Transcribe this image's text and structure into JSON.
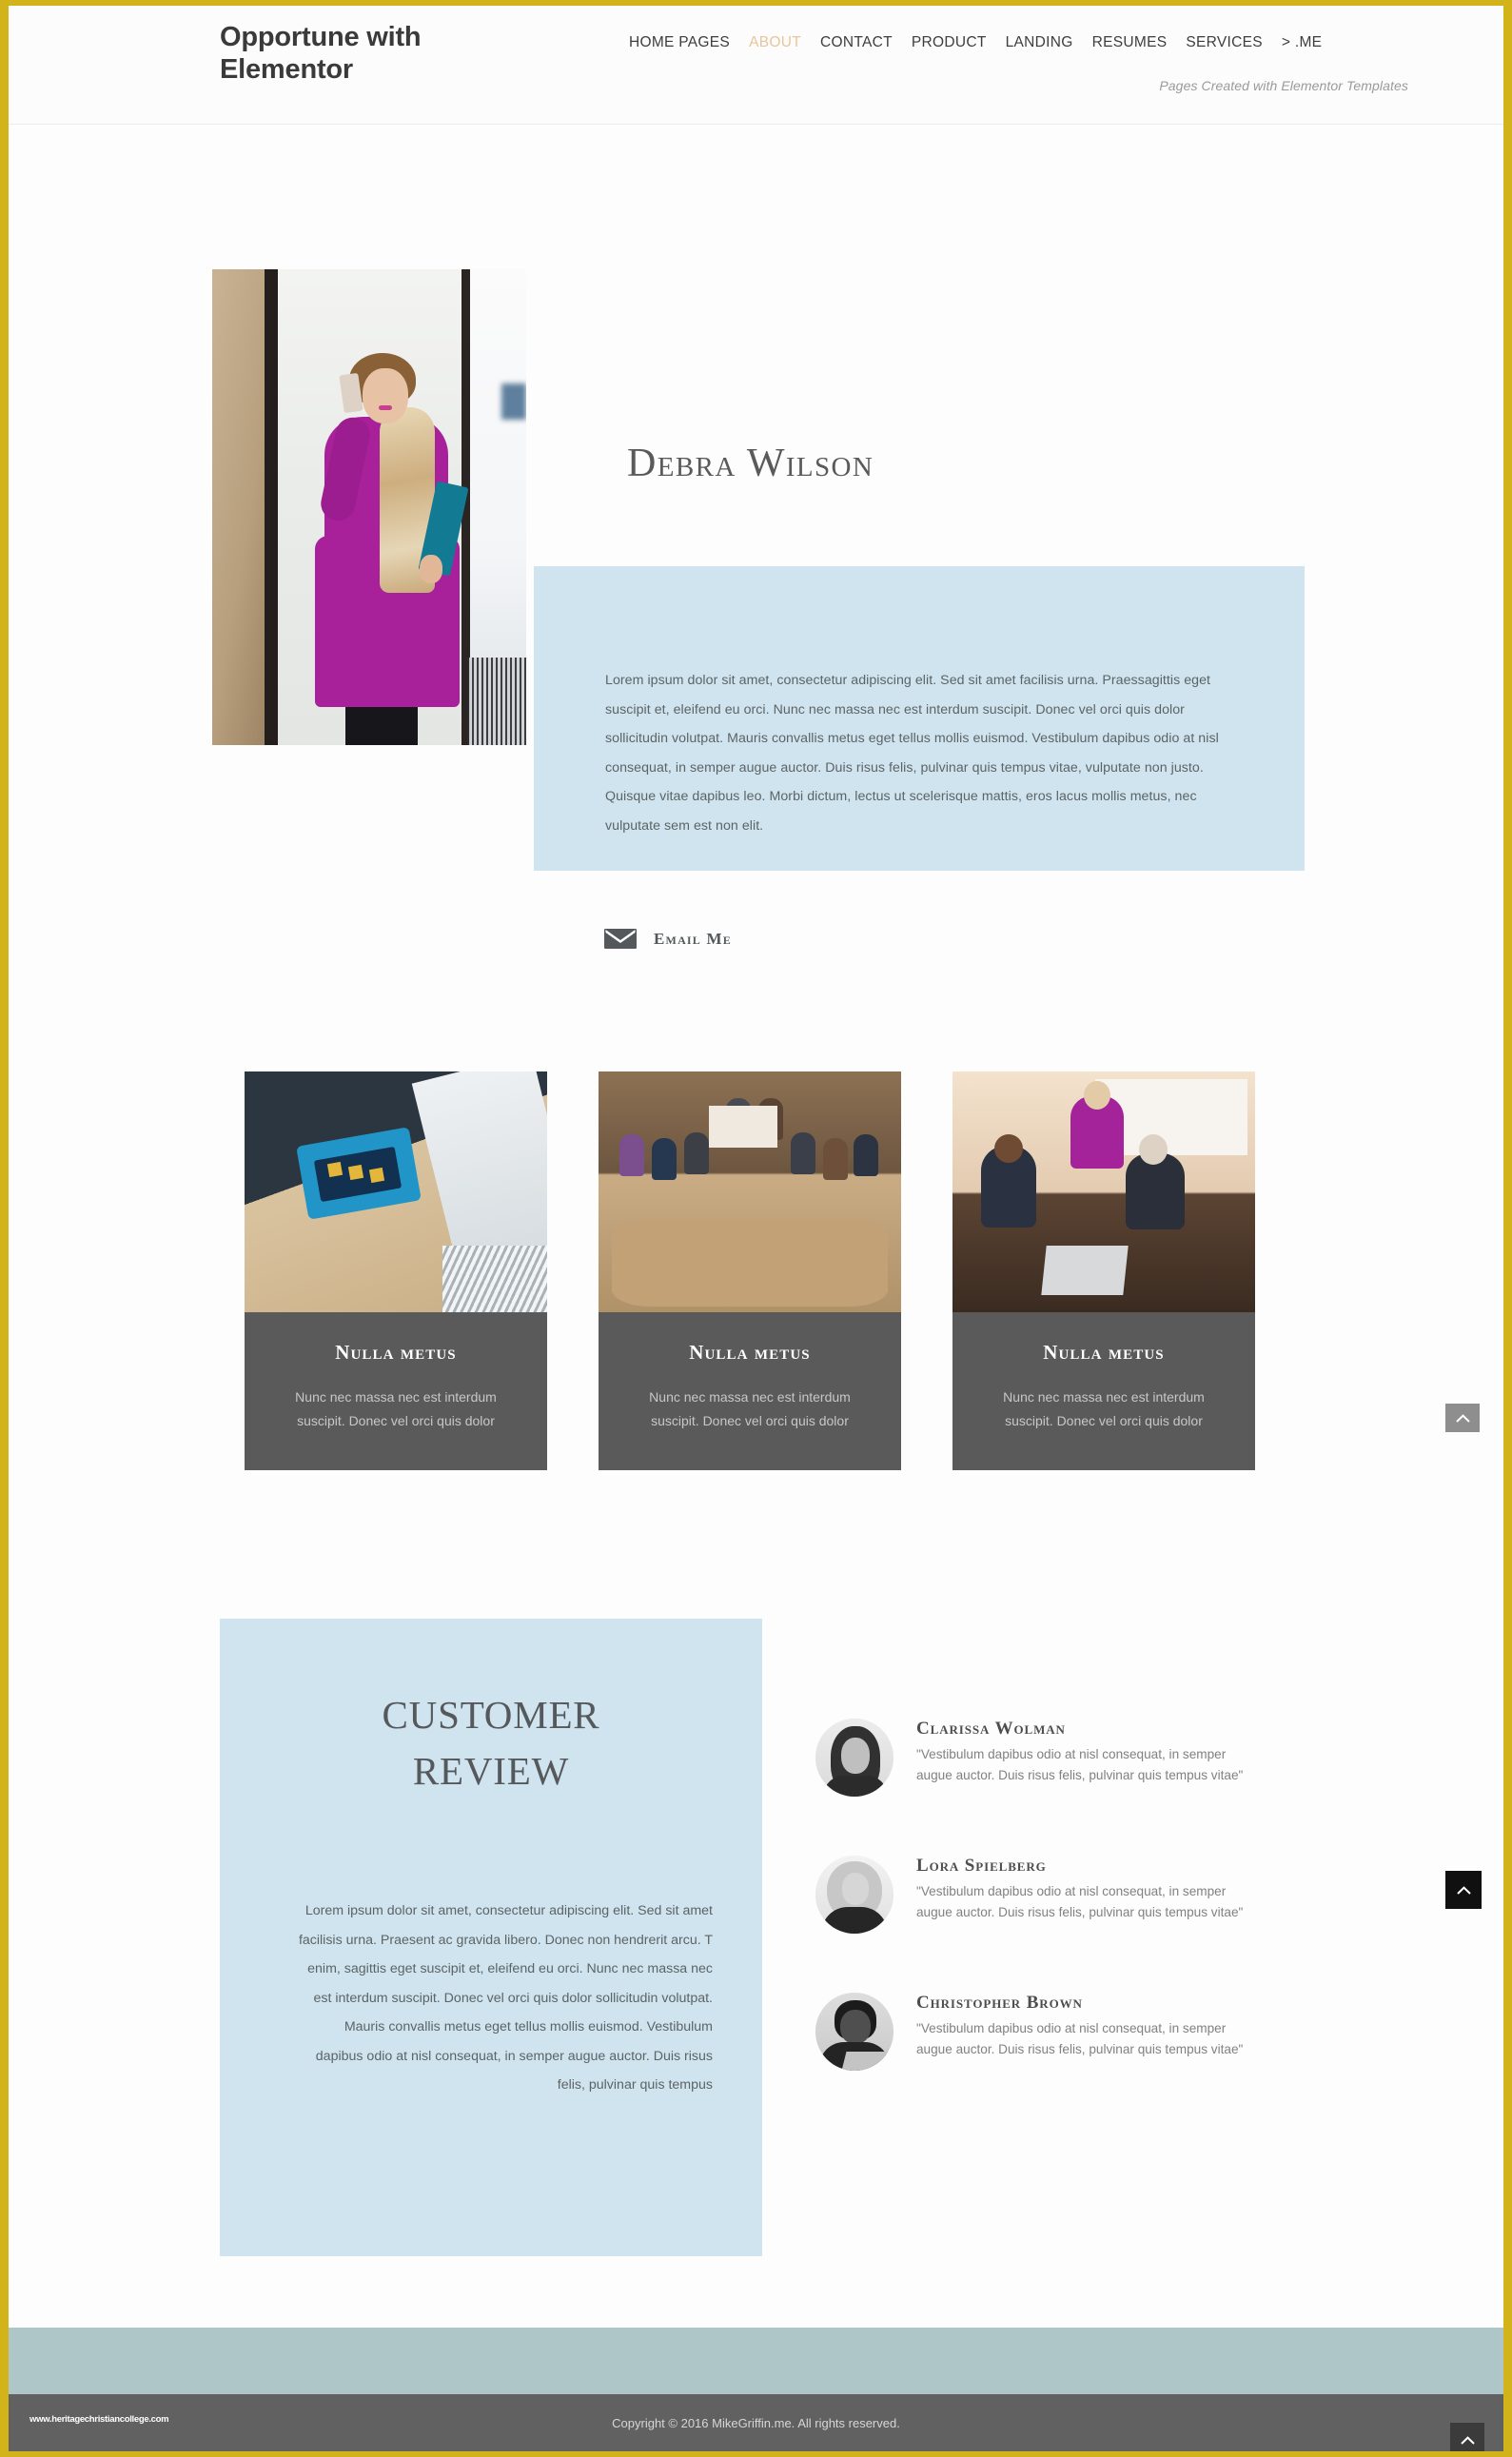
{
  "header": {
    "brand": "Opportune with Elementor",
    "tagline": "Pages Created with Elementor Templates",
    "nav": [
      {
        "label": "HOME PAGES",
        "active": false
      },
      {
        "label": "ABOUT",
        "active": true
      },
      {
        "label": "CONTACT",
        "active": false
      },
      {
        "label": "PRODUCT",
        "active": false
      },
      {
        "label": "LANDING",
        "active": false
      },
      {
        "label": "RESUMES",
        "active": false
      },
      {
        "label": "SERVICES",
        "active": false
      },
      {
        "label": "> .ME",
        "active": false
      }
    ]
  },
  "hero": {
    "name": "Debra Wilson",
    "bio": "Lorem ipsum dolor sit amet, consectetur adipiscing elit. Sed sit amet facilisis urna. Praessagittis eget suscipit et, eleifend eu orci. Nunc nec massa nec est interdum suscipit. Donec vel orci quis dolor sollicitudin volutpat. Mauris convallis metus eget tellus mollis euismod. Vestibulum dapibus odio at nisl consequat, in semper augue auctor. Duis risus felis, pulvinar quis tempus vitae, vulputate non justo. Quisque vitae dapibus leo. Morbi dictum, lectus ut scelerisque mattis, eros lacus mollis metus, nec vulputate sem est non elit.",
    "email_label": "Email Me",
    "email_icon": "envelope-icon",
    "photo_alt": "woman-in-magenta-dress-on-phone"
  },
  "cards": [
    {
      "title": "Nulla metus",
      "text": "Nunc nec massa nec est interdum suscipit. Donec vel orci quis dolor",
      "image_alt": "person-holding-blue-tablet"
    },
    {
      "title": "Nulla metus",
      "text": "Nunc nec massa nec est interdum suscipit. Donec vel orci quis dolor",
      "image_alt": "people-in-conference-meeting"
    },
    {
      "title": "Nulla metus",
      "text": "Nunc nec massa nec est interdum suscipit. Donec vel orci quis dolor",
      "image_alt": "team-collaborating-at-desk"
    }
  ],
  "review": {
    "title_line1": "CUSTOMER",
    "title_line2": "REVIEW",
    "text": "Lorem ipsum dolor sit amet, consectetur adipiscing elit. Sed sit amet facilisis urna. Praesent ac gravida libero. Donec non hendrerit arcu. T enim, sagittis eget suscipit et, eleifend eu orci. Nunc nec massa nec est interdum suscipit. Donec vel orci quis dolor sollicitudin volutpat. Mauris convallis metus eget tellus mollis euismod. Vestibulum dapibus odio at nisl consequat, in semper augue auctor. Duis risus felis, pulvinar quis tempus",
    "testimonials": [
      {
        "name": "Clarissa Wolman",
        "quote": "\"Vestibulum dapibus odio at nisl consequat, in semper augue auctor. Duis risus felis, pulvinar quis tempus vitae\"",
        "avatar_alt": "clarissa-wolman-portrait"
      },
      {
        "name": "Lora Spielberg",
        "quote": "\"Vestibulum dapibus odio at nisl consequat, in semper augue auctor. Duis risus felis, pulvinar quis tempus vitae\"",
        "avatar_alt": "lora-spielberg-portrait"
      },
      {
        "name": "Christopher Brown",
        "quote": "\"Vestibulum dapibus odio at nisl consequat, in semper augue auctor. Duis risus felis, pulvinar quis tempus vitae\"",
        "avatar_alt": "christopher-brown-portrait"
      }
    ]
  },
  "footer": {
    "copyright": "Copyright © 2016 MikeGriffin.me. All rights reserved.",
    "watermark": "www.heritagechristiancollege.com"
  },
  "scroll_buttons": {
    "icon": "chevron-up-icon"
  },
  "colors": {
    "page_border": "#d2b319",
    "accent_tan": "#e8c59a",
    "panel_blue": "#cfe4ef",
    "card_gray": "#5a5a5a",
    "footer_band": "#aec6c7",
    "footer_bar": "#616161"
  }
}
